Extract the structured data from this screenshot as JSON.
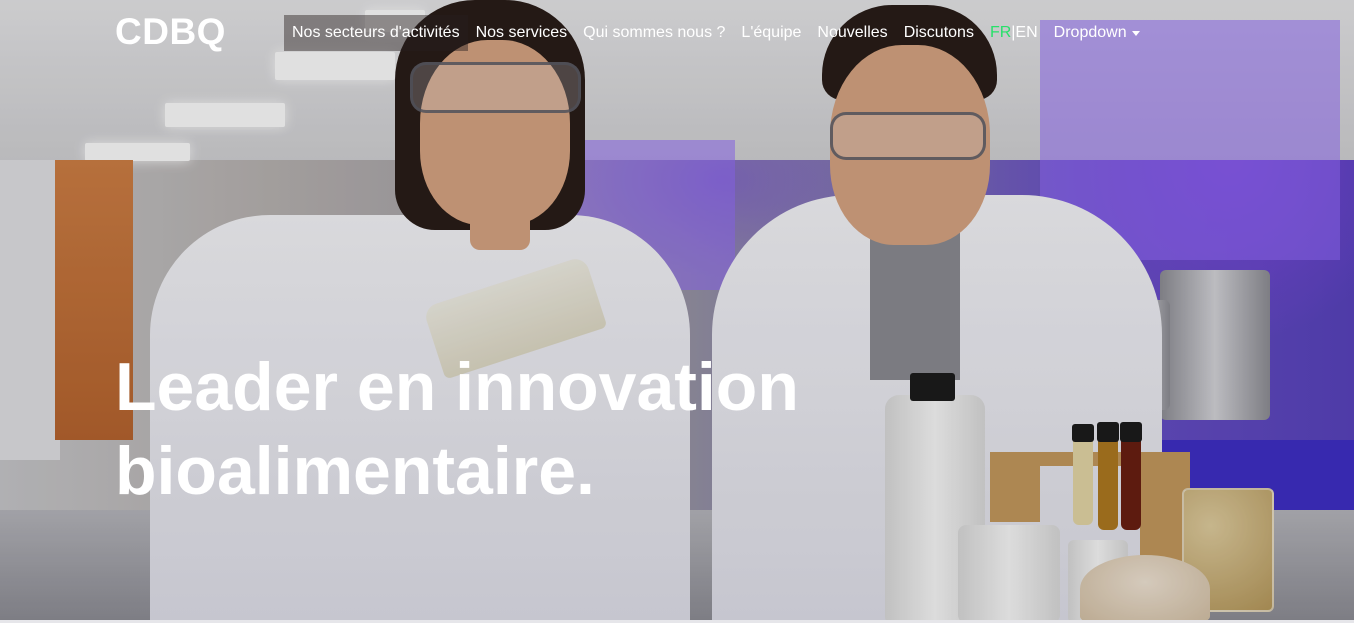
{
  "navbar": {
    "brand": "CDBQ",
    "links": [
      {
        "label": "Nos secteurs d'activités",
        "active": true
      },
      {
        "label": "Nos services"
      },
      {
        "label": "Qui sommes nous ?"
      },
      {
        "label": "L'équipe"
      },
      {
        "label": "Nouvelles"
      },
      {
        "label": "Discutons"
      }
    ],
    "language": {
      "fr": "FR",
      "separator": "|",
      "en": "EN",
      "active_color": "#28e06a"
    },
    "dropdown_label": "Dropdown",
    "dropdown_icon": "caret-down-icon"
  },
  "hero": {
    "headline_line1": "Leader en innovation",
    "headline_line2": "bioalimentaire.",
    "background_image": "laboratory-scientists-photo"
  },
  "colors": {
    "text": "#ffffff",
    "accent_green": "#28e06a",
    "lab_purple": "#5a44c0"
  }
}
